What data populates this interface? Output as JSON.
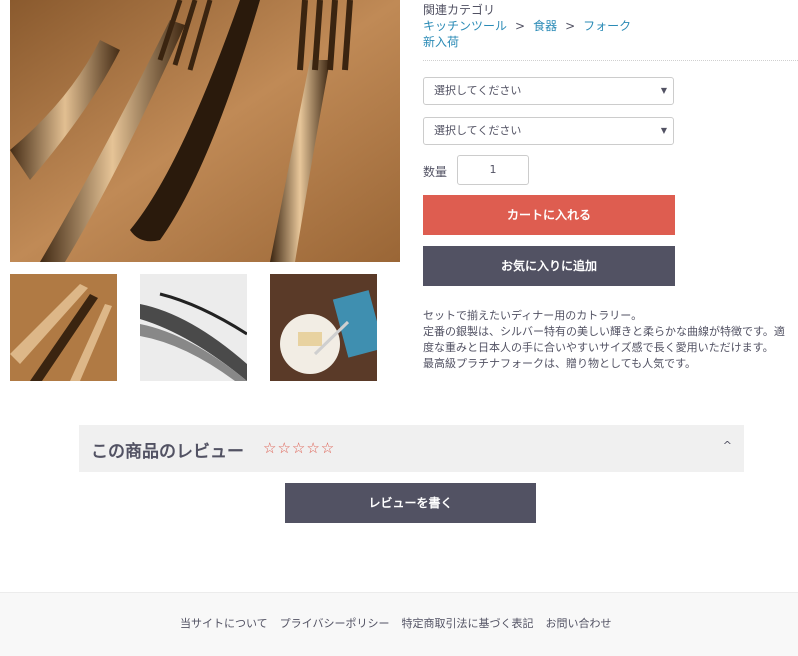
{
  "product": {
    "main_image": "fork-cutlery-photo",
    "thumbnails": [
      "forks-on-table-thumb",
      "forks-closeup-thumb",
      "cake-plate-thumb"
    ]
  },
  "category": {
    "label": "関連カテゴリ",
    "breadcrumb": [
      "キッチンツール",
      "食器",
      "フォーク"
    ],
    "separator": ">",
    "new_arrival": "新入荷"
  },
  "options": {
    "select1": "選択してください",
    "select2": "選択してください"
  },
  "quantity": {
    "label": "数量",
    "value": "1"
  },
  "buttons": {
    "add_to_cart": "カートに入れる",
    "add_to_favorites": "お気に入りに追加",
    "write_review": "レビューを書く"
  },
  "description": [
    "セットで揃えたいディナー用のカトラリー。",
    "定番の銀製は、シルバー特有の美しい輝きと柔らかな曲線が特徴です。適",
    "度な重みと日本人の手に合いやすいサイズ感で長く愛用いただけます。",
    "最高級プラチナフォークは、贈り物としても人気です。"
  ],
  "review": {
    "title": "この商品のレビュー",
    "stars": "☆☆☆☆☆",
    "toggle": "^"
  },
  "footer": {
    "links": [
      "当サイトについて",
      "プライバシーポリシー",
      "特定商取引法に基づく表記",
      "お問い合わせ"
    ]
  },
  "colors": {
    "accent": "#de5d50",
    "dark": "#525263",
    "link": "#2b8bb6"
  }
}
